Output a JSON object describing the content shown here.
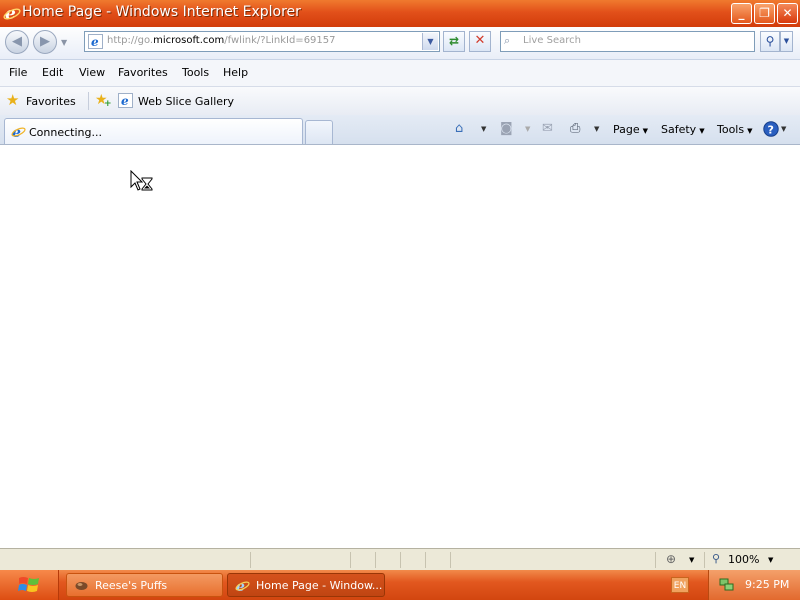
{
  "window": {
    "title": "Home Page - Windows Internet Explorer",
    "minimize_glyph": "_",
    "maximize_glyph": "❐",
    "close_glyph": "✕"
  },
  "address": {
    "url_prefix": "http://go.",
    "url_domain": "microsoft.com",
    "url_suffix": "/fwlink/?LinkId=69157"
  },
  "search": {
    "placeholder": "Live Search"
  },
  "menu": {
    "items": [
      "File",
      "Edit",
      "View",
      "Favorites",
      "Tools",
      "Help"
    ]
  },
  "favorites_bar": {
    "favorites_label": "Favorites",
    "web_slice_label": "Web Slice Gallery"
  },
  "tabs": {
    "active_label": "Connecting..."
  },
  "command_bar": {
    "page_label": "Page",
    "safety_label": "Safety",
    "tools_label": "Tools",
    "icons": [
      "home-icon",
      "feeds-icon",
      "read-mail-icon",
      "print-icon",
      "help-icon"
    ]
  },
  "status_bar": {
    "zoom": "100%"
  },
  "taskbar": {
    "items": [
      {
        "label": "Reese's Puffs",
        "icon": "window-icon"
      },
      {
        "label": "Home Page - Window...",
        "icon": "ie-icon"
      }
    ],
    "language": "EN",
    "clock": "9:25 PM"
  },
  "colors": {
    "titlebar": "#e2501a",
    "taskbar": "#d2460f",
    "chrome_light": "#e9eef8",
    "link_blue": "#2a4f9c"
  }
}
